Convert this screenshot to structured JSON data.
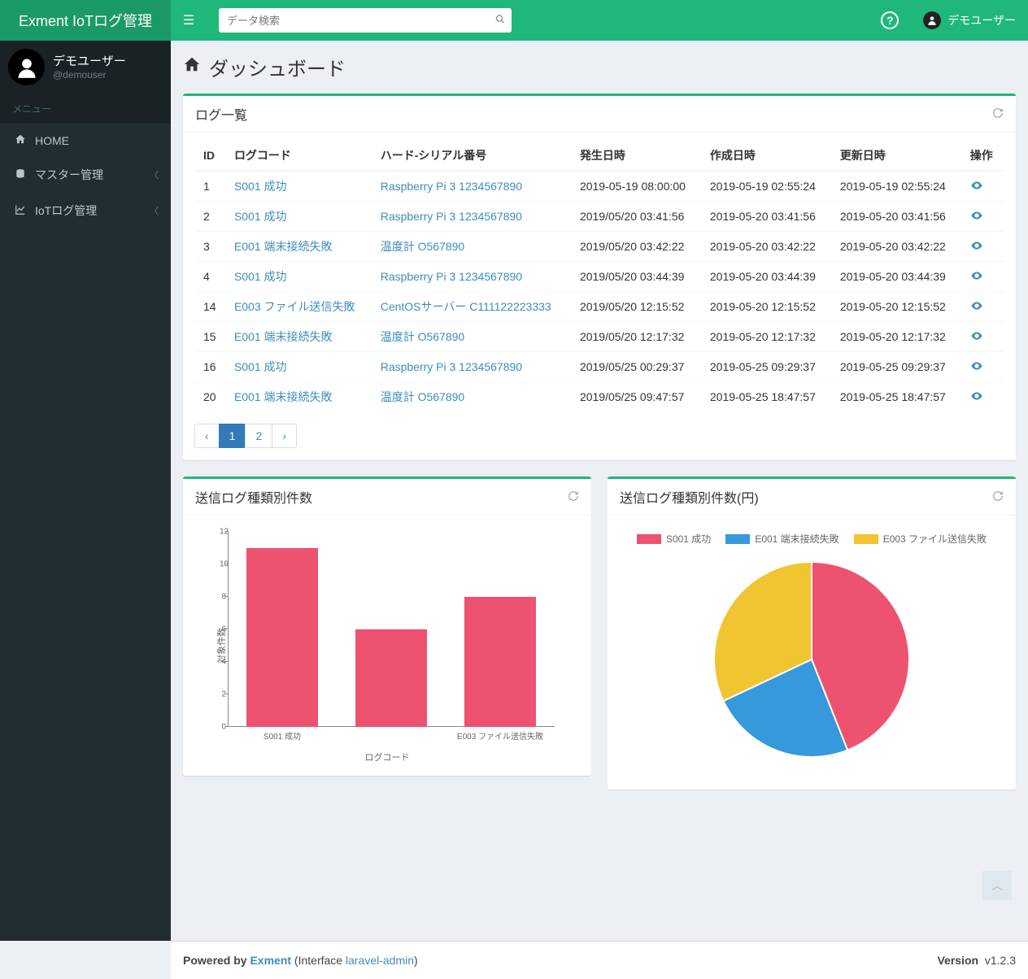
{
  "app": {
    "title": "Exment IoTログ管理"
  },
  "header": {
    "search_placeholder": "データ検索",
    "user_display": "デモユーザー"
  },
  "sidebar": {
    "user": {
      "name": "デモユーザー",
      "handle": "@demouser"
    },
    "menu_header": "メニュー",
    "items": [
      {
        "label": "HOME",
        "icon": "home-icon",
        "chev": false
      },
      {
        "label": "マスター管理",
        "icon": "database-icon",
        "chev": true
      },
      {
        "label": "IoTログ管理",
        "icon": "linechart-icon",
        "chev": true
      }
    ]
  },
  "page": {
    "title": "ダッシュボード"
  },
  "log_list": {
    "title": "ログ一覧",
    "columns": [
      "ID",
      "ログコード",
      "ハード-シリアル番号",
      "発生日時",
      "作成日時",
      "更新日時",
      "操作"
    ],
    "rows": [
      {
        "id": "1",
        "code": "S001 成功",
        "hw": "Raspberry Pi 3 1234567890",
        "occurred": "2019-05-19 08:00:00",
        "created": "2019-05-19 02:55:24",
        "updated": "2019-05-19 02:55:24"
      },
      {
        "id": "2",
        "code": "S001 成功",
        "hw": "Raspberry Pi 3 1234567890",
        "occurred": "2019/05/20 03:41:56",
        "created": "2019-05-20 03:41:56",
        "updated": "2019-05-20 03:41:56"
      },
      {
        "id": "3",
        "code": "E001 端末接続失敗",
        "hw": "温度計 O567890",
        "occurred": "2019/05/20 03:42:22",
        "created": "2019-05-20 03:42:22",
        "updated": "2019-05-20 03:42:22"
      },
      {
        "id": "4",
        "code": "S001 成功",
        "hw": "Raspberry Pi 3 1234567890",
        "occurred": "2019/05/20 03:44:39",
        "created": "2019-05-20 03:44:39",
        "updated": "2019-05-20 03:44:39"
      },
      {
        "id": "14",
        "code": "E003 ファイル送信失敗",
        "hw": "CentOSサーバー C111122223333",
        "occurred": "2019/05/20 12:15:52",
        "created": "2019-05-20 12:15:52",
        "updated": "2019-05-20 12:15:52"
      },
      {
        "id": "15",
        "code": "E001 端末接続失敗",
        "hw": "温度計 O567890",
        "occurred": "2019/05/20 12:17:32",
        "created": "2019-05-20 12:17:32",
        "updated": "2019-05-20 12:17:32"
      },
      {
        "id": "16",
        "code": "S001 成功",
        "hw": "Raspberry Pi 3 1234567890",
        "occurred": "2019/05/25 00:29:37",
        "created": "2019-05-25 09:29:37",
        "updated": "2019-05-25 09:29:37"
      },
      {
        "id": "20",
        "code": "E001 端末接続失敗",
        "hw": "温度計 O567890",
        "occurred": "2019/05/25 09:47:57",
        "created": "2019-05-25 18:47:57",
        "updated": "2019-05-25 18:47:57"
      }
    ],
    "pagination": {
      "prev": "‹",
      "pages": [
        "1",
        "2"
      ],
      "next": "›",
      "active": "1"
    }
  },
  "bar_panel": {
    "title": "送信ログ種類別件数"
  },
  "pie_panel": {
    "title": "送信ログ種類別件数(円)"
  },
  "footer": {
    "powered_prefix": "Powered by ",
    "powered_link": "Exment",
    "powered_suffix1": " (Interface ",
    "powered_link2": "laravel-admin",
    "powered_suffix2": ")",
    "version_label": "Version",
    "version": "v1.2.3"
  },
  "colors": {
    "pink": "#ee5271",
    "blue": "#3599db",
    "yellow": "#f1c431"
  },
  "chart_data": [
    {
      "type": "bar",
      "title": "送信ログ種類別件数",
      "xlabel": "ログコード",
      "ylabel": "対象件数",
      "ylim": [
        0,
        12
      ],
      "yticks": [
        0,
        2,
        4,
        6,
        8,
        10,
        12
      ],
      "categories": [
        "S001 成功",
        "E001 端末接続失敗",
        "E003 ファイル送信失敗"
      ],
      "xtick_labels_shown": [
        "S001 成功",
        "",
        "E003 ファイル送信失敗"
      ],
      "values": [
        11,
        6,
        8
      ],
      "color": "#ee5271"
    },
    {
      "type": "pie",
      "title": "送信ログ種類別件数(円)",
      "series": [
        {
          "name": "S001 成功",
          "value": 11,
          "color": "#ee5271"
        },
        {
          "name": "E001 端末接続失敗",
          "value": 6,
          "color": "#3599db"
        },
        {
          "name": "E003 ファイル送信失敗",
          "value": 8,
          "color": "#f1c431"
        }
      ]
    }
  ]
}
